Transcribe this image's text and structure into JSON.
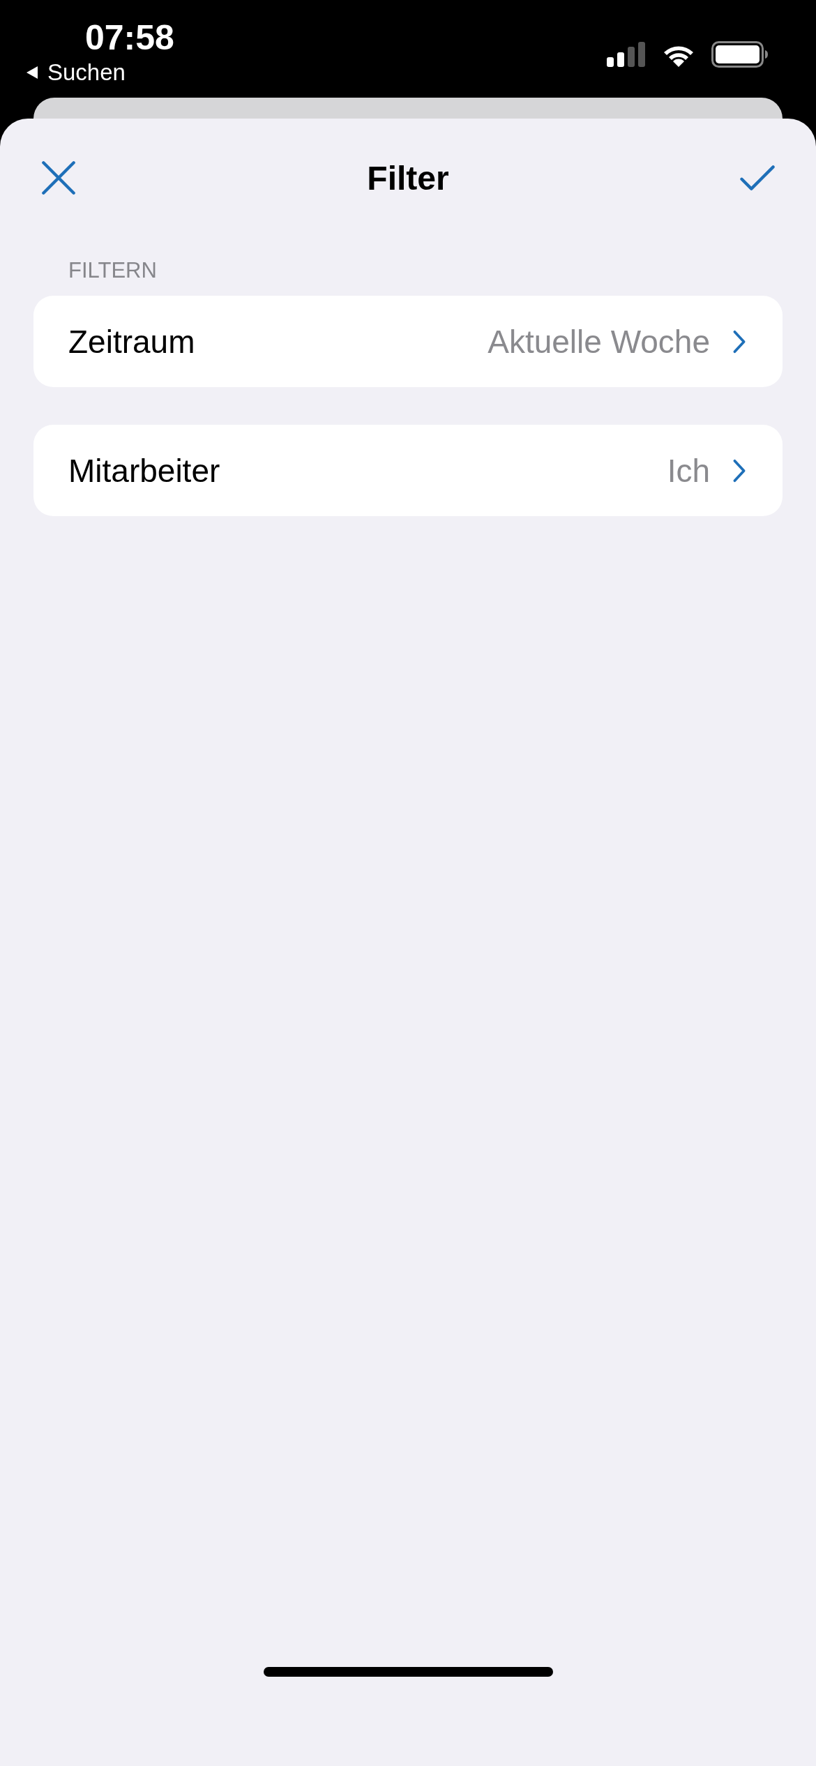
{
  "status_bar": {
    "time": "07:58",
    "back_label": "Suchen"
  },
  "header": {
    "title": "Filter"
  },
  "section": {
    "label": "FILTERN"
  },
  "rows": [
    {
      "label": "Zeitraum",
      "value": "Aktuelle Woche"
    },
    {
      "label": "Mitarbeiter",
      "value": "Ich"
    }
  ]
}
